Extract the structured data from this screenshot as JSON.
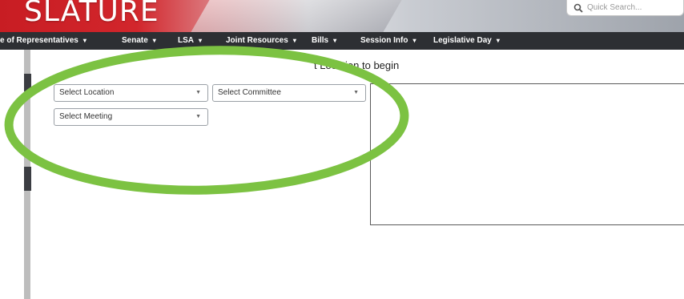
{
  "header": {
    "title": "SLATURE",
    "search_placeholder": "Quick Search...",
    "icons": {
      "search": "search-icon"
    }
  },
  "nav": {
    "items": [
      {
        "label": "e of Representatives",
        "caret": "▾"
      },
      {
        "label": "Senate",
        "caret": "▾"
      },
      {
        "label": "LSA",
        "caret": "▾"
      },
      {
        "label": "Joint Resources",
        "caret": "▾"
      },
      {
        "label": "Bills",
        "caret": "▾"
      },
      {
        "label": "Session Info",
        "caret": "▾"
      },
      {
        "label": "Legislative Day",
        "caret": "▾"
      }
    ]
  },
  "main": {
    "prompt": "t Location to begin",
    "selects": {
      "location": "Select Location",
      "committee": "Select Committee",
      "meeting": "Select Meeting"
    }
  },
  "colors": {
    "navbar": "#2d2f33",
    "annotation": "#7cc242",
    "banner_red": "#c81d23"
  }
}
